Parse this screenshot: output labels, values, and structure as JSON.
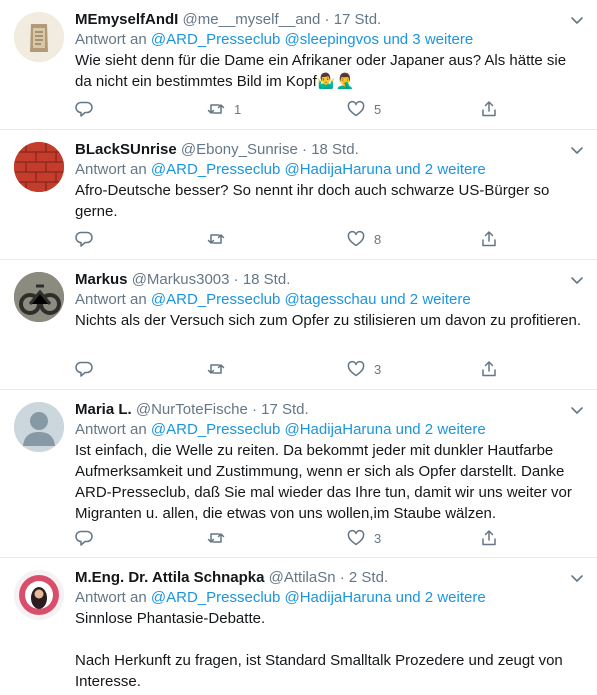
{
  "tweets": [
    {
      "name": "MEmyselfAndI",
      "handle": "@me__myself__and",
      "dot": "·",
      "time": "17 Std.",
      "reply_prefix": "Antwort an",
      "reply_to": "@ARD_Presseclub @sleepingvos und 3 weitere",
      "paragraphs": [
        "Wie sieht denn für die Dame ein Afrikaner oder Japaner aus? Als hätte sie da nicht ein bestimmtes Bild im Kopf🤷‍♂️🤦‍♂️"
      ],
      "replies": "",
      "retweets": "1",
      "likes": "5",
      "avatar_color": "#c9b79a"
    },
    {
      "name": "BLackSUnrise",
      "handle": "@Ebony_Sunrise",
      "dot": "·",
      "time": "18 Std.",
      "reply_prefix": "Antwort an",
      "reply_to": "@ARD_Presseclub @HadijaHaruna und 2 weitere",
      "paragraphs": [
        "Afro-Deutsche besser? So nennt ihr doch auch schwarze US-Bürger so gerne."
      ],
      "replies": "",
      "retweets": "",
      "likes": "8",
      "avatar_color": "#c0392b"
    },
    {
      "name": "Markus",
      "handle": "@Markus3003",
      "dot": "·",
      "time": "18 Std.",
      "reply_prefix": "Antwort an",
      "reply_to": "@ARD_Presseclub @tagesschau und 2 weitere",
      "paragraphs": [
        "Nichts als der Versuch sich zum Opfer zu stilisieren um davon zu profitieren."
      ],
      "replies": "",
      "retweets": "",
      "likes": "3",
      "avatar_color": "#4a4a44"
    },
    {
      "name": "Maria L.",
      "handle": "@NurToteFische",
      "dot": "·",
      "time": "17 Std.",
      "reply_prefix": "Antwort an",
      "reply_to": "@ARD_Presseclub @HadijaHaruna und 2 weitere",
      "paragraphs": [
        "Ist einfach, die Welle zu reiten. Da bekommt jeder mit dunkler Hautfarbe Aufmerksamkeit und Zustimmung, wenn er sich als Opfer darstellt. Danke ARD-Presseclub, daß Sie mal wieder das Ihre tun, damit wir uns weiter vor Migranten u. allen, die etwas von uns wollen,im Staube wälzen."
      ],
      "replies": "",
      "retweets": "",
      "likes": "3",
      "avatar_color": "#ccd6dd"
    },
    {
      "name": "M.Eng. Dr. Attila Schnapka",
      "handle": "@AttilaSn",
      "dot": "·",
      "time": "2 Std.",
      "reply_prefix": "Antwort an",
      "reply_to": "@ARD_Presseclub @HadijaHaruna und 2 weitere",
      "paragraphs": [
        "Sinnlose Phantasie-Debatte.",
        "Nach Herkunft zu fragen, ist Standard Smalltalk Prozedere und zeugt von Interesse."
      ],
      "replies": "",
      "retweets": "",
      "likes": "",
      "avatar_color": "#d35470"
    }
  ]
}
